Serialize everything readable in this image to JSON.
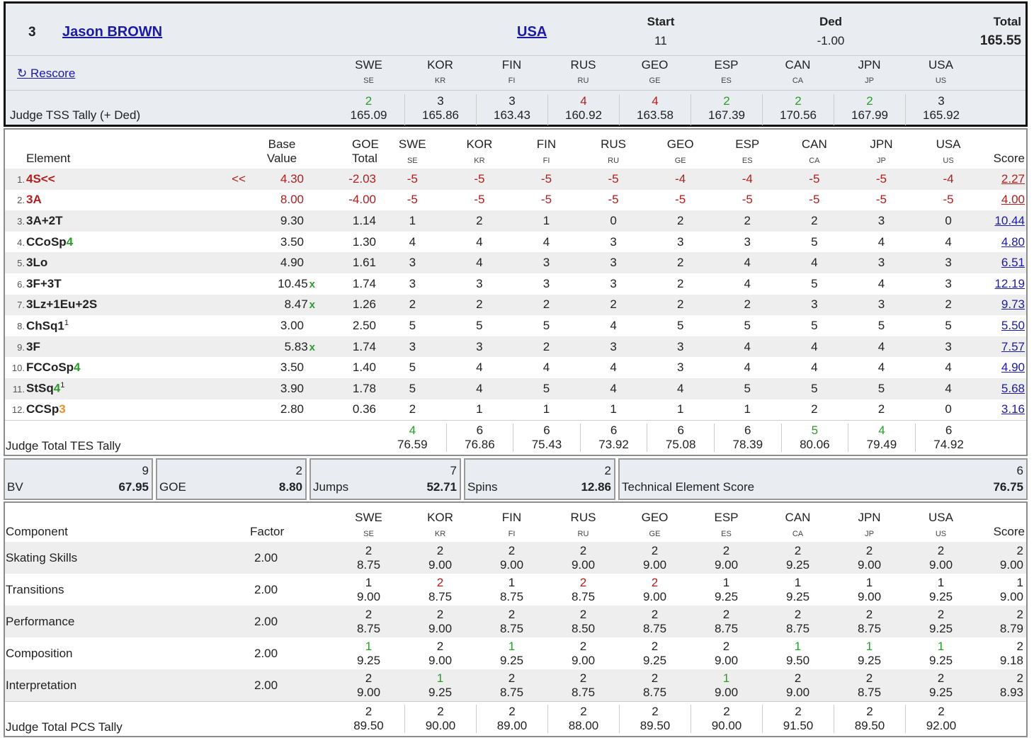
{
  "colors": {
    "green": "#2a9d2a",
    "red": "#b01e1e",
    "orange": "#e8922a",
    "link": "#1a1aa6"
  },
  "header": {
    "rank": "3",
    "name": "Jason BROWN",
    "nation": "USA",
    "start_label": "Start",
    "start": "11",
    "ded_label": "Ded",
    "ded": "-1.00",
    "total_label": "Total",
    "total": "165.55",
    "rescore_label": "↻ Rescore",
    "tss_label": "Judge TSS Tally (+ Ded)"
  },
  "judges": [
    {
      "n": "SWE",
      "c": "SE"
    },
    {
      "n": "KOR",
      "c": "KR"
    },
    {
      "n": "FIN",
      "c": "FI"
    },
    {
      "n": "RUS",
      "c": "RU"
    },
    {
      "n": "GEO",
      "c": "GE"
    },
    {
      "n": "ESP",
      "c": "ES"
    },
    {
      "n": "CAN",
      "c": "CA"
    },
    {
      "n": "JPN",
      "c": "JP"
    },
    {
      "n": "USA",
      "c": "US"
    }
  ],
  "tss_tally": [
    {
      "k": "2",
      "v": "165.09",
      "col": "green"
    },
    {
      "k": "3",
      "v": "165.86"
    },
    {
      "k": "3",
      "v": "163.43"
    },
    {
      "k": "4",
      "v": "160.92",
      "col": "red"
    },
    {
      "k": "4",
      "v": "163.58",
      "col": "red"
    },
    {
      "k": "2",
      "v": "167.39",
      "col": "green"
    },
    {
      "k": "2",
      "v": "170.56",
      "col": "green"
    },
    {
      "k": "2",
      "v": "167.99",
      "col": "green"
    },
    {
      "k": "3",
      "v": "165.92"
    }
  ],
  "elements_header": {
    "element": "Element",
    "base_value": "Base Value",
    "goe_total": "GOE Total",
    "score": "Score"
  },
  "elements": [
    {
      "num": "1.",
      "code": "4S<<",
      "marker": "<<",
      "bv": "4.30",
      "goe": "-2.03",
      "j": [
        "-5",
        "-5",
        "-5",
        "-5",
        "-4",
        "-4",
        "-5",
        "-5",
        "-4"
      ],
      "score": "2.27",
      "red": true
    },
    {
      "num": "2.",
      "code": "3A",
      "bv": "8.00",
      "goe": "-4.00",
      "j": [
        "-5",
        "-5",
        "-5",
        "-5",
        "-5",
        "-5",
        "-5",
        "-5",
        "-5"
      ],
      "score": "4.00",
      "red": true
    },
    {
      "num": "3.",
      "code": "3A+2T",
      "bv": "9.30",
      "goe": "1.14",
      "j": [
        "1",
        "2",
        "1",
        "0",
        "2",
        "2",
        "2",
        "3",
        "0"
      ],
      "score": "10.44"
    },
    {
      "num": "4.",
      "code": "CCoSp",
      "level": "4",
      "level_col": "green",
      "bv": "3.50",
      "goe": "1.30",
      "j": [
        "4",
        "4",
        "4",
        "3",
        "3",
        "3",
        "5",
        "4",
        "4"
      ],
      "score": "4.80"
    },
    {
      "num": "5.",
      "code": "3Lo",
      "bv": "4.90",
      "goe": "1.61",
      "j": [
        "3",
        "4",
        "3",
        "3",
        "2",
        "4",
        "4",
        "3",
        "3"
      ],
      "score": "6.51"
    },
    {
      "num": "6.",
      "code": "3F+3T",
      "bv": "10.45",
      "x": "x",
      "goe": "1.74",
      "j": [
        "3",
        "3",
        "3",
        "3",
        "2",
        "4",
        "5",
        "4",
        "3"
      ],
      "score": "12.19"
    },
    {
      "num": "7.",
      "code": "3Lz+1Eu+2S",
      "bv": "8.47",
      "x": "x",
      "goe": "1.26",
      "j": [
        "2",
        "2",
        "2",
        "2",
        "2",
        "2",
        "3",
        "3",
        "2"
      ],
      "score": "9.73"
    },
    {
      "num": "8.",
      "code": "ChSq1",
      "sup": "1",
      "bv": "3.00",
      "goe": "2.50",
      "j": [
        "5",
        "5",
        "5",
        "4",
        "5",
        "5",
        "5",
        "5",
        "5"
      ],
      "score": "5.50"
    },
    {
      "num": "9.",
      "code": "3F",
      "bv": "5.83",
      "x": "x",
      "goe": "1.74",
      "j": [
        "3",
        "3",
        "2",
        "3",
        "3",
        "4",
        "4",
        "4",
        "3"
      ],
      "score": "7.57"
    },
    {
      "num": "10.",
      "code": "FCCoSp",
      "level": "4",
      "level_col": "green",
      "bv": "3.50",
      "goe": "1.40",
      "j": [
        "5",
        "4",
        "4",
        "4",
        "3",
        "4",
        "4",
        "4",
        "4"
      ],
      "score": "4.90"
    },
    {
      "num": "11.",
      "code": "StSq",
      "level": "4",
      "level_col": "green",
      "sup": "1",
      "bv": "3.90",
      "goe": "1.78",
      "j": [
        "5",
        "4",
        "5",
        "4",
        "4",
        "5",
        "5",
        "5",
        "4"
      ],
      "score": "5.68"
    },
    {
      "num": "12.",
      "code": "CCSp",
      "level": "3",
      "level_col": "orange",
      "bv": "2.80",
      "goe": "0.36",
      "j": [
        "2",
        "1",
        "1",
        "1",
        "1",
        "1",
        "2",
        "2",
        "0"
      ],
      "score": "3.16"
    }
  ],
  "tes_tally": {
    "label": "Judge Total TES Tally",
    "cells": [
      {
        "k": "4",
        "v": "76.59",
        "col": "green"
      },
      {
        "k": "6",
        "v": "76.86"
      },
      {
        "k": "6",
        "v": "75.43"
      },
      {
        "k": "6",
        "v": "73.92"
      },
      {
        "k": "6",
        "v": "75.08"
      },
      {
        "k": "6",
        "v": "78.39"
      },
      {
        "k": "5",
        "v": "80.06",
        "col": "green"
      },
      {
        "k": "4",
        "v": "79.49",
        "col": "green"
      },
      {
        "k": "6",
        "v": "74.92"
      }
    ]
  },
  "summary": [
    {
      "label": "BV",
      "count": "9",
      "value": "67.95"
    },
    {
      "label": "GOE",
      "count": "2",
      "value": "8.80"
    },
    {
      "label": "Jumps",
      "count": "7",
      "value": "52.71"
    },
    {
      "label": "Spins",
      "count": "2",
      "value": "12.86"
    },
    {
      "label": "Technical Element Score",
      "count": "6",
      "value": "76.75"
    }
  ],
  "pcs_header": {
    "component": "Component",
    "factor": "Factor",
    "score": "Score"
  },
  "components": [
    {
      "name": "Skating Skills",
      "factor": "2.00",
      "k": [
        "2",
        "2",
        "2",
        "2",
        "2",
        "2",
        "2",
        "2",
        "2"
      ],
      "kc": [],
      "v": [
        "8.75",
        "9.00",
        "9.00",
        "9.00",
        "9.00",
        "9.00",
        "9.25",
        "9.00",
        "9.00"
      ],
      "sk": "2",
      "sv": "9.00"
    },
    {
      "name": "Transitions",
      "factor": "2.00",
      "k": [
        "1",
        "2",
        "1",
        "2",
        "2",
        "1",
        "1",
        "1",
        "1"
      ],
      "kc": [
        "",
        "red",
        "",
        "red",
        "red",
        "",
        "",
        "",
        ""
      ],
      "v": [
        "9.00",
        "8.75",
        "8.75",
        "8.75",
        "9.00",
        "9.25",
        "9.25",
        "9.00",
        "9.25"
      ],
      "sk": "1",
      "sv": "9.00"
    },
    {
      "name": "Performance",
      "factor": "2.00",
      "k": [
        "2",
        "2",
        "2",
        "2",
        "2",
        "2",
        "2",
        "2",
        "2"
      ],
      "kc": [],
      "v": [
        "8.75",
        "9.00",
        "8.75",
        "8.50",
        "8.75",
        "8.75",
        "8.75",
        "8.75",
        "9.25"
      ],
      "sk": "2",
      "sv": "8.79"
    },
    {
      "name": "Composition",
      "factor": "2.00",
      "k": [
        "1",
        "2",
        "1",
        "2",
        "2",
        "2",
        "1",
        "1",
        "1"
      ],
      "kc": [
        "green",
        "",
        "green",
        "",
        "",
        "",
        "green",
        "green",
        "green"
      ],
      "v": [
        "9.25",
        "9.00",
        "9.25",
        "9.00",
        "9.25",
        "9.00",
        "9.50",
        "9.25",
        "9.25"
      ],
      "sk": "2",
      "sv": "9.18"
    },
    {
      "name": "Interpretation",
      "factor": "2.00",
      "k": [
        "2",
        "1",
        "2",
        "2",
        "2",
        "1",
        "2",
        "2",
        "2"
      ],
      "kc": [
        "",
        "green",
        "",
        "",
        "",
        "green",
        "",
        "",
        ""
      ],
      "v": [
        "9.00",
        "9.25",
        "8.75",
        "8.75",
        "8.75",
        "9.00",
        "9.00",
        "8.75",
        "9.25"
      ],
      "sk": "2",
      "sv": "8.93"
    }
  ],
  "pcs_tally": {
    "label": "Judge Total PCS Tally",
    "cells": [
      {
        "k": "2",
        "v": "89.50"
      },
      {
        "k": "2",
        "v": "90.00"
      },
      {
        "k": "2",
        "v": "89.00"
      },
      {
        "k": "2",
        "v": "88.00"
      },
      {
        "k": "2",
        "v": "89.50"
      },
      {
        "k": "2",
        "v": "90.00"
      },
      {
        "k": "2",
        "v": "91.50"
      },
      {
        "k": "2",
        "v": "89.50"
      },
      {
        "k": "2",
        "v": "92.00"
      }
    ]
  }
}
